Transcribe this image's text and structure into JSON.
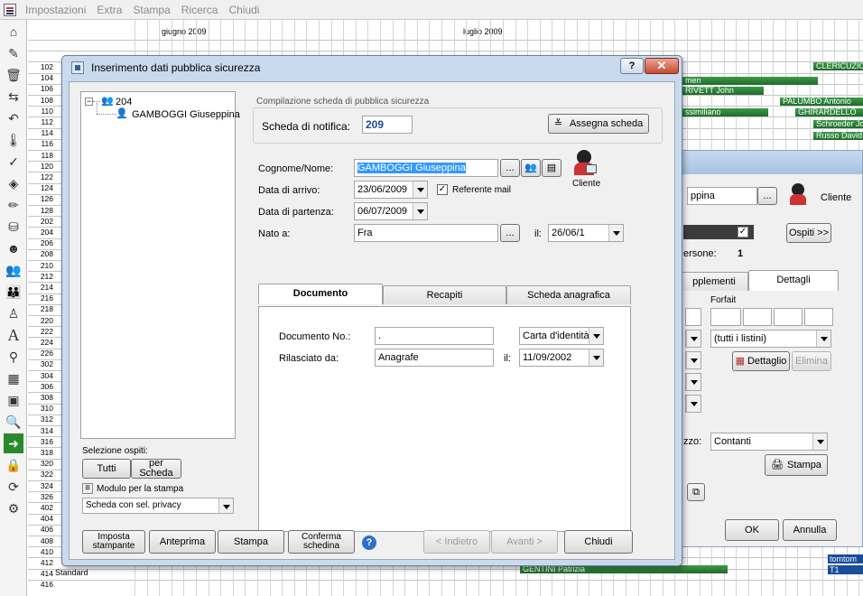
{
  "menu": [
    "Impostazioni",
    "Extra",
    "Stampa",
    "Ricerca",
    "Chiudi"
  ],
  "grid": {
    "months": [
      "giugno 2009",
      "luglio 2009"
    ],
    "rooms": [
      "102",
      "104",
      "106",
      "108",
      "110",
      "112",
      "114",
      "116",
      "118",
      "120",
      "122",
      "124",
      "126",
      "128",
      "202",
      "204",
      "206",
      "208",
      "210",
      "212",
      "214",
      "216",
      "218",
      "220",
      "222",
      "224",
      "226",
      "302",
      "304",
      "306",
      "308",
      "310",
      "312",
      "314",
      "316",
      "318",
      "320",
      "322",
      "324",
      "326",
      "402",
      "404",
      "406",
      "408",
      "410",
      "412",
      "414",
      "416"
    ],
    "bottom_room_label": "Standard",
    "guests_right": [
      "CLERICUZIO",
      "RIVETT John",
      "PALUMBO Antonio",
      "GHIRARDELLO",
      "Schroeder Jo",
      "Russo David",
      "tomtom",
      "T1",
      "GENTINI Patrizia",
      "men",
      "ssimiliano"
    ]
  },
  "bg_dialog": {
    "name_value": "ppina",
    "client_label": "Cliente",
    "ospiti_button": "Ospiti >>",
    "persone_label": "ersone:",
    "persone_value": "1",
    "tab_supplementi": "pplementi",
    "tab_dettagli": "Dettagli",
    "forfait_label": "Forfait",
    "listini_value": "(tutti i listini)",
    "dettaglio_button": "Dettaglio",
    "elimina_button": "Elimina",
    "pagamento_label": "zzo:",
    "pagamento_value": "Contanti",
    "stampa_button": "Stampa",
    "ok_button": "OK",
    "annulla_button": "Annulla"
  },
  "dialog": {
    "title": "Inserimento dati pubblica sicurezza",
    "tree": {
      "room": "204",
      "guest": "GAMBOGGI Giuseppina"
    },
    "selezione_label": "Selezione ospiti:",
    "tutti_button": "Tutti",
    "per_scheda_button": "per Scheda",
    "modulo_label": "Modulo per la stampa",
    "modulo_value": "Scheda con sel. privacy",
    "group_title": "Compilazione scheda di pubblica sicurezza",
    "scheda_label": "Scheda di notifica:",
    "scheda_value": "209",
    "assegna_button": "Assegna scheda",
    "cognome_label": "Cognome/Nome:",
    "cognome_value": "GAMBOGGI Giuseppina",
    "ellipsis": "...",
    "cliente_label": "Cliente",
    "arrivo_label": "Data di arrivo:",
    "arrivo_value": "23/06/2009",
    "referente_label": "Referente mail",
    "partenza_label": "Data di partenza:",
    "partenza_value": "06/07/2009",
    "nato_label": "Nato a:",
    "nato_value": "Fra",
    "il_label": "il:",
    "nato_il_value": "26/06/1",
    "tabs": [
      "Documento",
      "Recapiti",
      "Scheda anagrafica"
    ],
    "documento_label": "Documento  No.:",
    "documento_value": ".",
    "documento_tipo": "Carta d'identità",
    "rilasciato_label": "Rilasciato da:",
    "rilasciato_value": "Anagrafe",
    "rilasciato_il_label": "il:",
    "rilasciato_il_value": "11/09/2002",
    "footer": {
      "imposta": "Imposta stampante",
      "anteprima": "Anteprima",
      "stampa": "Stampa",
      "conferma": "Conferma schedina",
      "indietro": "< Indietro",
      "avanti": "Avanti >",
      "chiudi": "Chiudi"
    }
  }
}
